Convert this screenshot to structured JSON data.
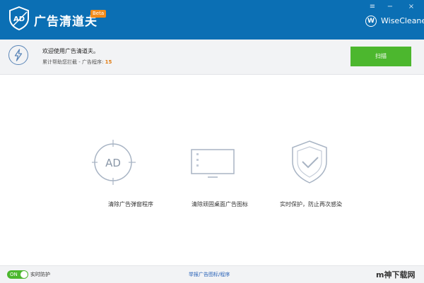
{
  "app": {
    "title": "广告清道夫",
    "badge": "Beta",
    "brand": "WiseCleaner",
    "brand_initial": "W",
    "accent_color": "#0b6fb4"
  },
  "header": {
    "welcome": "欢迎使用广告清道夫。",
    "stats_prefix": "累计帮助您拦截 - ",
    "stats_label": "广告程序:",
    "stats_count": "15",
    "scan_button": "扫描"
  },
  "features": [
    {
      "label": "清除广告弹窗程序",
      "icon": "ad-block-icon"
    },
    {
      "label": "清除顽固桌面广告图标",
      "icon": "monitor-icon"
    },
    {
      "label": "实时保护，防止再次感染",
      "icon": "shield-check-icon"
    }
  ],
  "footer": {
    "toggle_text": "ON",
    "realtime_label": "实时防护",
    "report_link": "举报广告图标/程序",
    "watermark": "m神下载网"
  }
}
